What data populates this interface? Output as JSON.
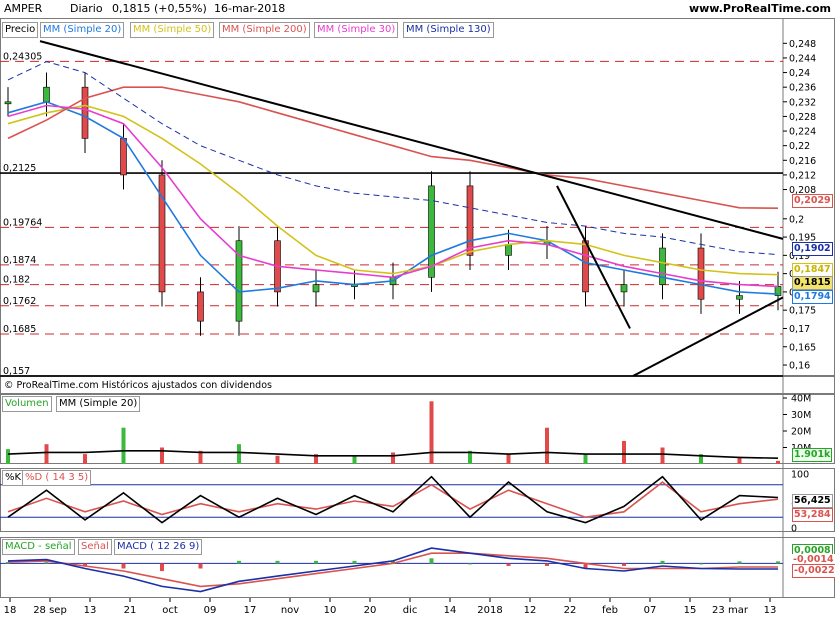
{
  "header": {
    "ticker": "AMPER",
    "period": "Diario",
    "price_change": "0,1815 (+0,55%)",
    "date": "16-mar-2018",
    "site": "www.ProRealTime.com"
  },
  "legend": [
    {
      "label": "Precio",
      "color": "#000000"
    },
    {
      "label": "MM (Simple 20)",
      "color": "#1f7ae0"
    },
    {
      "label": "MM (Simple 50)",
      "color": "#d4c21a"
    },
    {
      "label": "MM (Simple 200)",
      "color": "#d9534f"
    },
    {
      "label": "MM (Simple 30)",
      "color": "#e83ccf"
    },
    {
      "label": "MM (Simple 130)",
      "color": "#1a2fa8"
    }
  ],
  "credit": "© ProRealTime.com  Históricos ajustados con dividendos",
  "price_axis": {
    "ticks": [
      "0,248",
      "0,244",
      "0,24",
      "0,236",
      "0,232",
      "0,228",
      "0,224",
      "0,22",
      "0,216",
      "0,212",
      "0,208",
      "0,2",
      "0,195",
      "0,19",
      "0,185",
      "0,18",
      "0,175",
      "0,17",
      "0,165",
      "0,16"
    ]
  },
  "level_labels": [
    "0,24305",
    "0,2125",
    "0,19764",
    "0,1874",
    "0,182",
    "0,1762",
    "0,1685",
    "0,157"
  ],
  "value_tags": [
    {
      "text": "0,2029",
      "color": "#d9534f"
    },
    {
      "text": "0,1902",
      "color": "#1a2fa8"
    },
    {
      "text": "0,1847",
      "color": "#d4c21a"
    },
    {
      "text": "0,1815",
      "color": "#000000"
    },
    {
      "text": "0,1794",
      "color": "#1f7ae0"
    }
  ],
  "volume_panel": {
    "legend": [
      "Volumen",
      "MM (Simple 20)"
    ],
    "ticks": [
      "40M",
      "30M",
      "20M",
      "10M"
    ],
    "tag": "1.901k"
  },
  "stoch_panel": {
    "legend": [
      "%K",
      "%D ( 14 3 5)"
    ],
    "ticks": [
      "100",
      "50",
      "0"
    ],
    "tags": [
      "56,425",
      "53,284"
    ]
  },
  "macd_panel": {
    "legend": [
      "MACD - señal",
      "Señal",
      "MACD ( 12 26 9)"
    ],
    "tags": [
      "0,0008",
      "-0,0014",
      "-0,0022"
    ]
  },
  "x_axis": {
    "labels": [
      "18",
      "28 sep",
      "13",
      "21",
      "oct",
      "09",
      "17",
      "nov",
      "10",
      "20",
      "dic",
      "14",
      "2018",
      "12",
      "22",
      "feb",
      "07",
      "15",
      "23 mar",
      "13"
    ]
  },
  "chart_data": [
    {
      "type": "line",
      "x": [
        "2017-08-18",
        "2017-08-28",
        "2017-09-13",
        "2017-09-21",
        "2017-10-02",
        "2017-10-09",
        "2017-10-17",
        "2017-11-02",
        "2017-11-10",
        "2017-11-20",
        "2017-12-04",
        "2017-12-14",
        "2018-01-02",
        "2018-01-12",
        "2018-01-22",
        "2018-02-01",
        "2018-02-07",
        "2018-02-15",
        "2018-03-01",
        "2018-03-13",
        "2018-03-16"
      ],
      "series": [
        {
          "name": "Precio",
          "values": [
            0.232,
            0.236,
            0.222,
            0.212,
            0.18,
            0.172,
            0.194,
            0.18,
            0.182,
            0.182,
            0.184,
            0.209,
            0.19,
            0.193,
            0.194,
            0.18,
            0.182,
            0.192,
            0.178,
            0.179,
            0.1815
          ]
        },
        {
          "name": "MM (Simple 20)",
          "values": [
            0.229,
            0.232,
            0.228,
            0.222,
            0.206,
            0.19,
            0.18,
            0.181,
            0.183,
            0.182,
            0.183,
            0.19,
            0.194,
            0.196,
            0.194,
            0.188,
            0.186,
            0.184,
            0.182,
            0.18,
            0.1794
          ]
        },
        {
          "name": "MM (Simple 50)",
          "values": [
            0.226,
            0.229,
            0.231,
            0.228,
            0.222,
            0.215,
            0.207,
            0.198,
            0.19,
            0.186,
            0.185,
            0.187,
            0.191,
            0.193,
            0.194,
            0.193,
            0.19,
            0.188,
            0.186,
            0.185,
            0.1847
          ]
        },
        {
          "name": "MM (Simple 200)",
          "values": [
            0.222,
            0.227,
            0.233,
            0.236,
            0.236,
            0.234,
            0.232,
            0.229,
            0.226,
            0.223,
            0.22,
            0.217,
            0.216,
            0.214,
            0.212,
            0.211,
            0.209,
            0.207,
            0.205,
            0.203,
            0.2029
          ]
        },
        {
          "name": "MM (Simple 30)",
          "values": [
            0.228,
            0.231,
            0.23,
            0.226,
            0.214,
            0.2,
            0.19,
            0.187,
            0.186,
            0.185,
            0.184,
            0.187,
            0.192,
            0.194,
            0.193,
            0.19,
            0.187,
            0.185,
            0.183,
            0.182,
            0.1815
          ]
        },
        {
          "name": "MM (Simple 130)",
          "values": [
            0.238,
            0.243,
            0.24,
            0.233,
            0.226,
            0.22,
            0.216,
            0.212,
            0.209,
            0.207,
            0.206,
            0.205,
            0.203,
            0.201,
            0.199,
            0.198,
            0.196,
            0.195,
            0.193,
            0.191,
            0.1902
          ]
        }
      ],
      "horizontal_levels": [
        0.24305,
        0.2125,
        0.19764,
        0.1874,
        0.182,
        0.1762,
        0.1685,
        0.157
      ],
      "ylim": [
        0.157,
        0.25
      ],
      "grid": false
    },
    {
      "type": "bar",
      "x": [
        "2017-08-18",
        "2017-08-28",
        "2017-09-13",
        "2017-09-21",
        "2017-10-02",
        "2017-10-09",
        "2017-10-17",
        "2017-11-02",
        "2017-11-10",
        "2017-11-20",
        "2017-12-04",
        "2017-12-14",
        "2018-01-02",
        "2018-01-12",
        "2018-01-22",
        "2018-02-01",
        "2018-02-07",
        "2018-02-15",
        "2018-03-01",
        "2018-03-13",
        "2018-03-16"
      ],
      "series": [
        {
          "name": "Volumen",
          "values": [
            9,
            12,
            6,
            22,
            10,
            8,
            12,
            5,
            6,
            5,
            7,
            38,
            8,
            6,
            22,
            6,
            14,
            10,
            6,
            4,
            1.9
          ]
        },
        {
          "name": "MM (Simple 20)",
          "values": [
            6,
            7,
            7,
            8,
            8,
            7,
            7,
            6,
            5,
            5,
            5,
            7,
            7,
            6,
            7,
            6,
            6,
            6,
            5,
            4,
            3.5
          ]
        }
      ],
      "ylim": [
        0,
        40
      ]
    },
    {
      "type": "line",
      "x": [
        "2017-08-18",
        "2017-08-28",
        "2017-09-13",
        "2017-09-21",
        "2017-10-02",
        "2017-10-09",
        "2017-10-17",
        "2017-11-02",
        "2017-11-10",
        "2017-11-20",
        "2017-12-04",
        "2017-12-14",
        "2018-01-02",
        "2018-01-12",
        "2018-01-22",
        "2018-02-01",
        "2018-02-07",
        "2018-02-15",
        "2018-03-01",
        "2018-03-13",
        "2018-03-16"
      ],
      "series": [
        {
          "name": "%K",
          "values": [
            20,
            70,
            15,
            65,
            10,
            60,
            20,
            55,
            25,
            60,
            30,
            95,
            20,
            85,
            30,
            10,
            40,
            95,
            15,
            60,
            56.425
          ]
        },
        {
          "name": "%D ( 14 3 5)",
          "values": [
            30,
            55,
            30,
            50,
            25,
            45,
            30,
            45,
            35,
            50,
            40,
            80,
            35,
            70,
            45,
            20,
            30,
            85,
            30,
            45,
            53.284
          ]
        }
      ],
      "ylim": [
        0,
        100
      ]
    },
    {
      "type": "line",
      "x": [
        "2017-08-18",
        "2017-08-28",
        "2017-09-13",
        "2017-09-21",
        "2017-10-02",
        "2017-10-09",
        "2017-10-17",
        "2017-11-02",
        "2017-11-10",
        "2017-11-20",
        "2017-12-04",
        "2017-12-14",
        "2018-01-02",
        "2018-01-12",
        "2018-01-22",
        "2018-02-01",
        "2018-02-07",
        "2018-02-15",
        "2018-03-01",
        "2018-03-13",
        "2018-03-16"
      ],
      "series": [
        {
          "name": "MACD ( 12 26 9)",
          "values": [
            0.001,
            0.0015,
            -0.002,
            -0.005,
            -0.009,
            -0.011,
            -0.007,
            -0.005,
            -0.003,
            -0.001,
            0.001,
            0.006,
            0.004,
            0.002,
            0.001,
            -0.002,
            -0.003,
            -0.001,
            -0.002,
            -0.0022,
            -0.0022
          ]
        },
        {
          "name": "Señal",
          "values": [
            0.0005,
            0.001,
            -0.001,
            -0.003,
            -0.006,
            -0.009,
            -0.008,
            -0.006,
            -0.004,
            -0.002,
            0.0,
            0.004,
            0.004,
            0.003,
            0.002,
            0.0,
            -0.002,
            -0.002,
            -0.002,
            -0.0014,
            -0.0014
          ]
        },
        {
          "name": "MACD - señal",
          "values": [
            0.0005,
            0.0005,
            -0.001,
            -0.002,
            -0.003,
            -0.002,
            0.001,
            0.001,
            0.001,
            0.001,
            0.001,
            0.002,
            0.0,
            -0.001,
            -0.001,
            -0.002,
            -0.001,
            0.001,
            0.0,
            0.0008,
            0.0008
          ]
        }
      ],
      "ylim": [
        -0.012,
        0.008
      ]
    }
  ]
}
